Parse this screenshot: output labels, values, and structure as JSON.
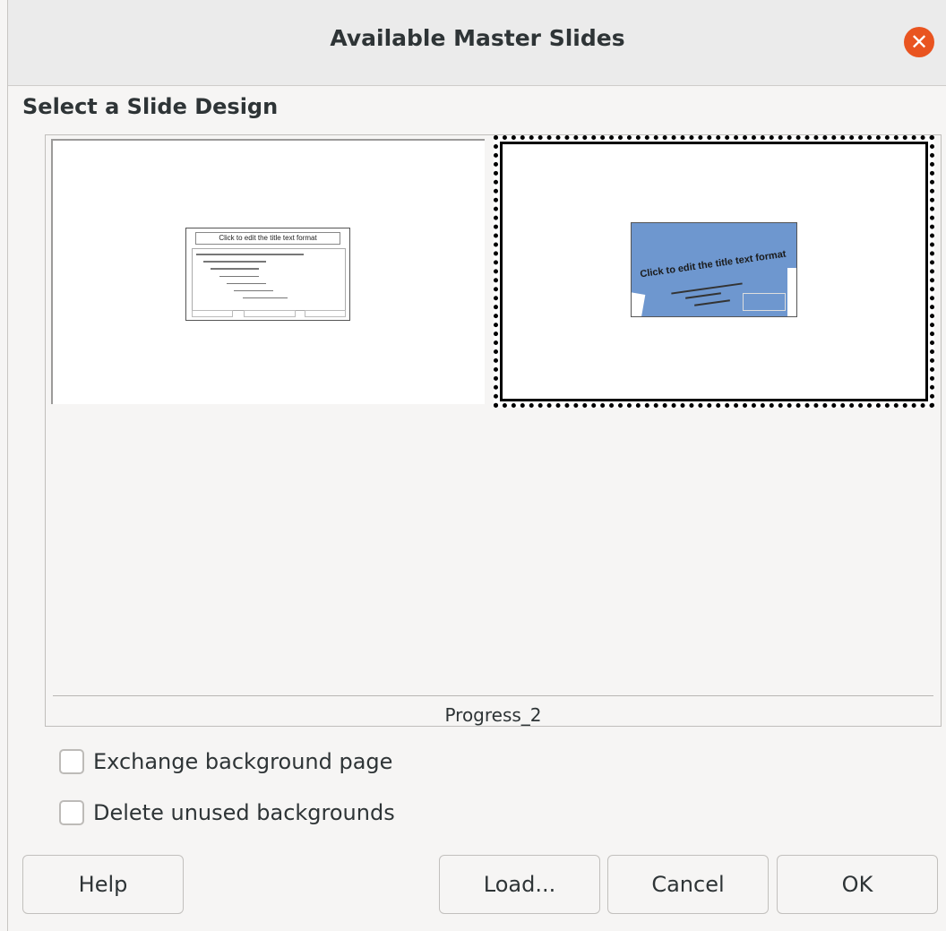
{
  "window": {
    "title": "Available Master Slides",
    "close_icon": "close-icon",
    "accent_color": "#e95420"
  },
  "section": {
    "label": "Select a Slide Design"
  },
  "designs": [
    {
      "preview_title": "Click to edit the title text format",
      "selected": false
    },
    {
      "preview_title": "Click to edit the title text format",
      "selected": true
    }
  ],
  "selected_design_name": "Progress_2",
  "options": {
    "exchange_background": {
      "label": "Exchange background page",
      "checked": false
    },
    "delete_unused": {
      "label": "Delete unused backgrounds",
      "checked": false
    }
  },
  "buttons": {
    "help": "Help",
    "load": "Load...",
    "cancel": "Cancel",
    "ok": "OK"
  }
}
